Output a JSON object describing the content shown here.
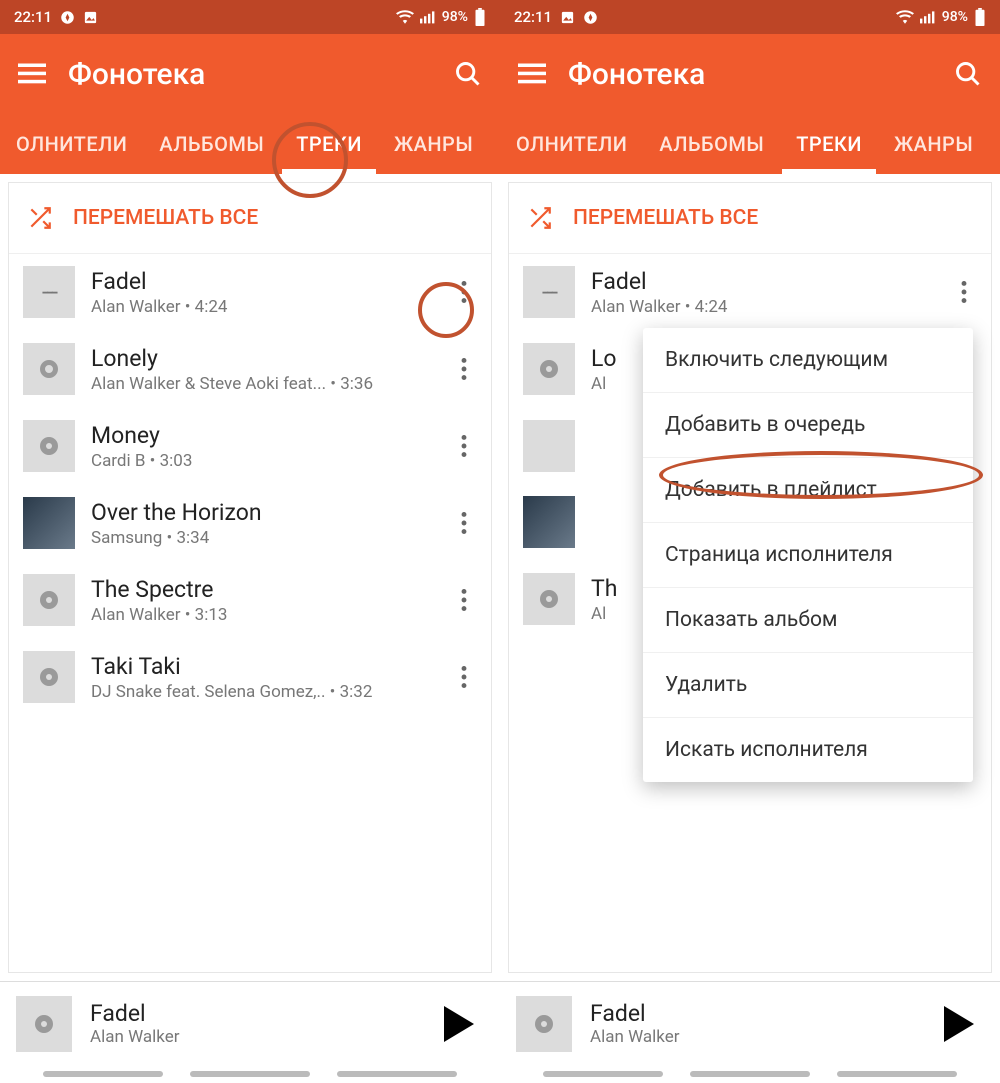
{
  "status": {
    "time": "22:11",
    "battery": "98%"
  },
  "appbar": {
    "title": "Фонотека"
  },
  "tabs": [
    {
      "label": "ОЛНИТЕЛИ"
    },
    {
      "label": "АЛЬБОМЫ"
    },
    {
      "label": "ТРЕКИ"
    },
    {
      "label": "ЖАНРЫ"
    }
  ],
  "shuffle_label": "ПЕРЕМЕШАТЬ ВСЕ",
  "tracks": [
    {
      "title": "Fadel",
      "sub": "Alan Walker • 4:24"
    },
    {
      "title": "Lonely",
      "sub": "Alan Walker & Steve Aoki feat... • 3:36"
    },
    {
      "title": "Money",
      "sub": "Cardi B • 3:03"
    },
    {
      "title": "Over the Horizon",
      "sub": "Samsung • 3:34"
    },
    {
      "title": "The Spectre",
      "sub": "Alan Walker • 3:13"
    },
    {
      "title": "Taki Taki",
      "sub": "DJ Snake feat. Selena Gomez,.. • 3:32"
    }
  ],
  "tracks_trunc": [
    {
      "title": "Lo",
      "sub": "Al"
    },
    {
      "title": "Th",
      "sub": "Al"
    }
  ],
  "nowplaying": {
    "title": "Fadel",
    "artist": "Alan Walker"
  },
  "menu": {
    "items": [
      "Включить следующим",
      "Добавить в очередь",
      "Добавить в плейлист",
      "Страница исполнителя",
      "Показать альбом",
      "Удалить",
      "Искать исполнителя"
    ]
  }
}
